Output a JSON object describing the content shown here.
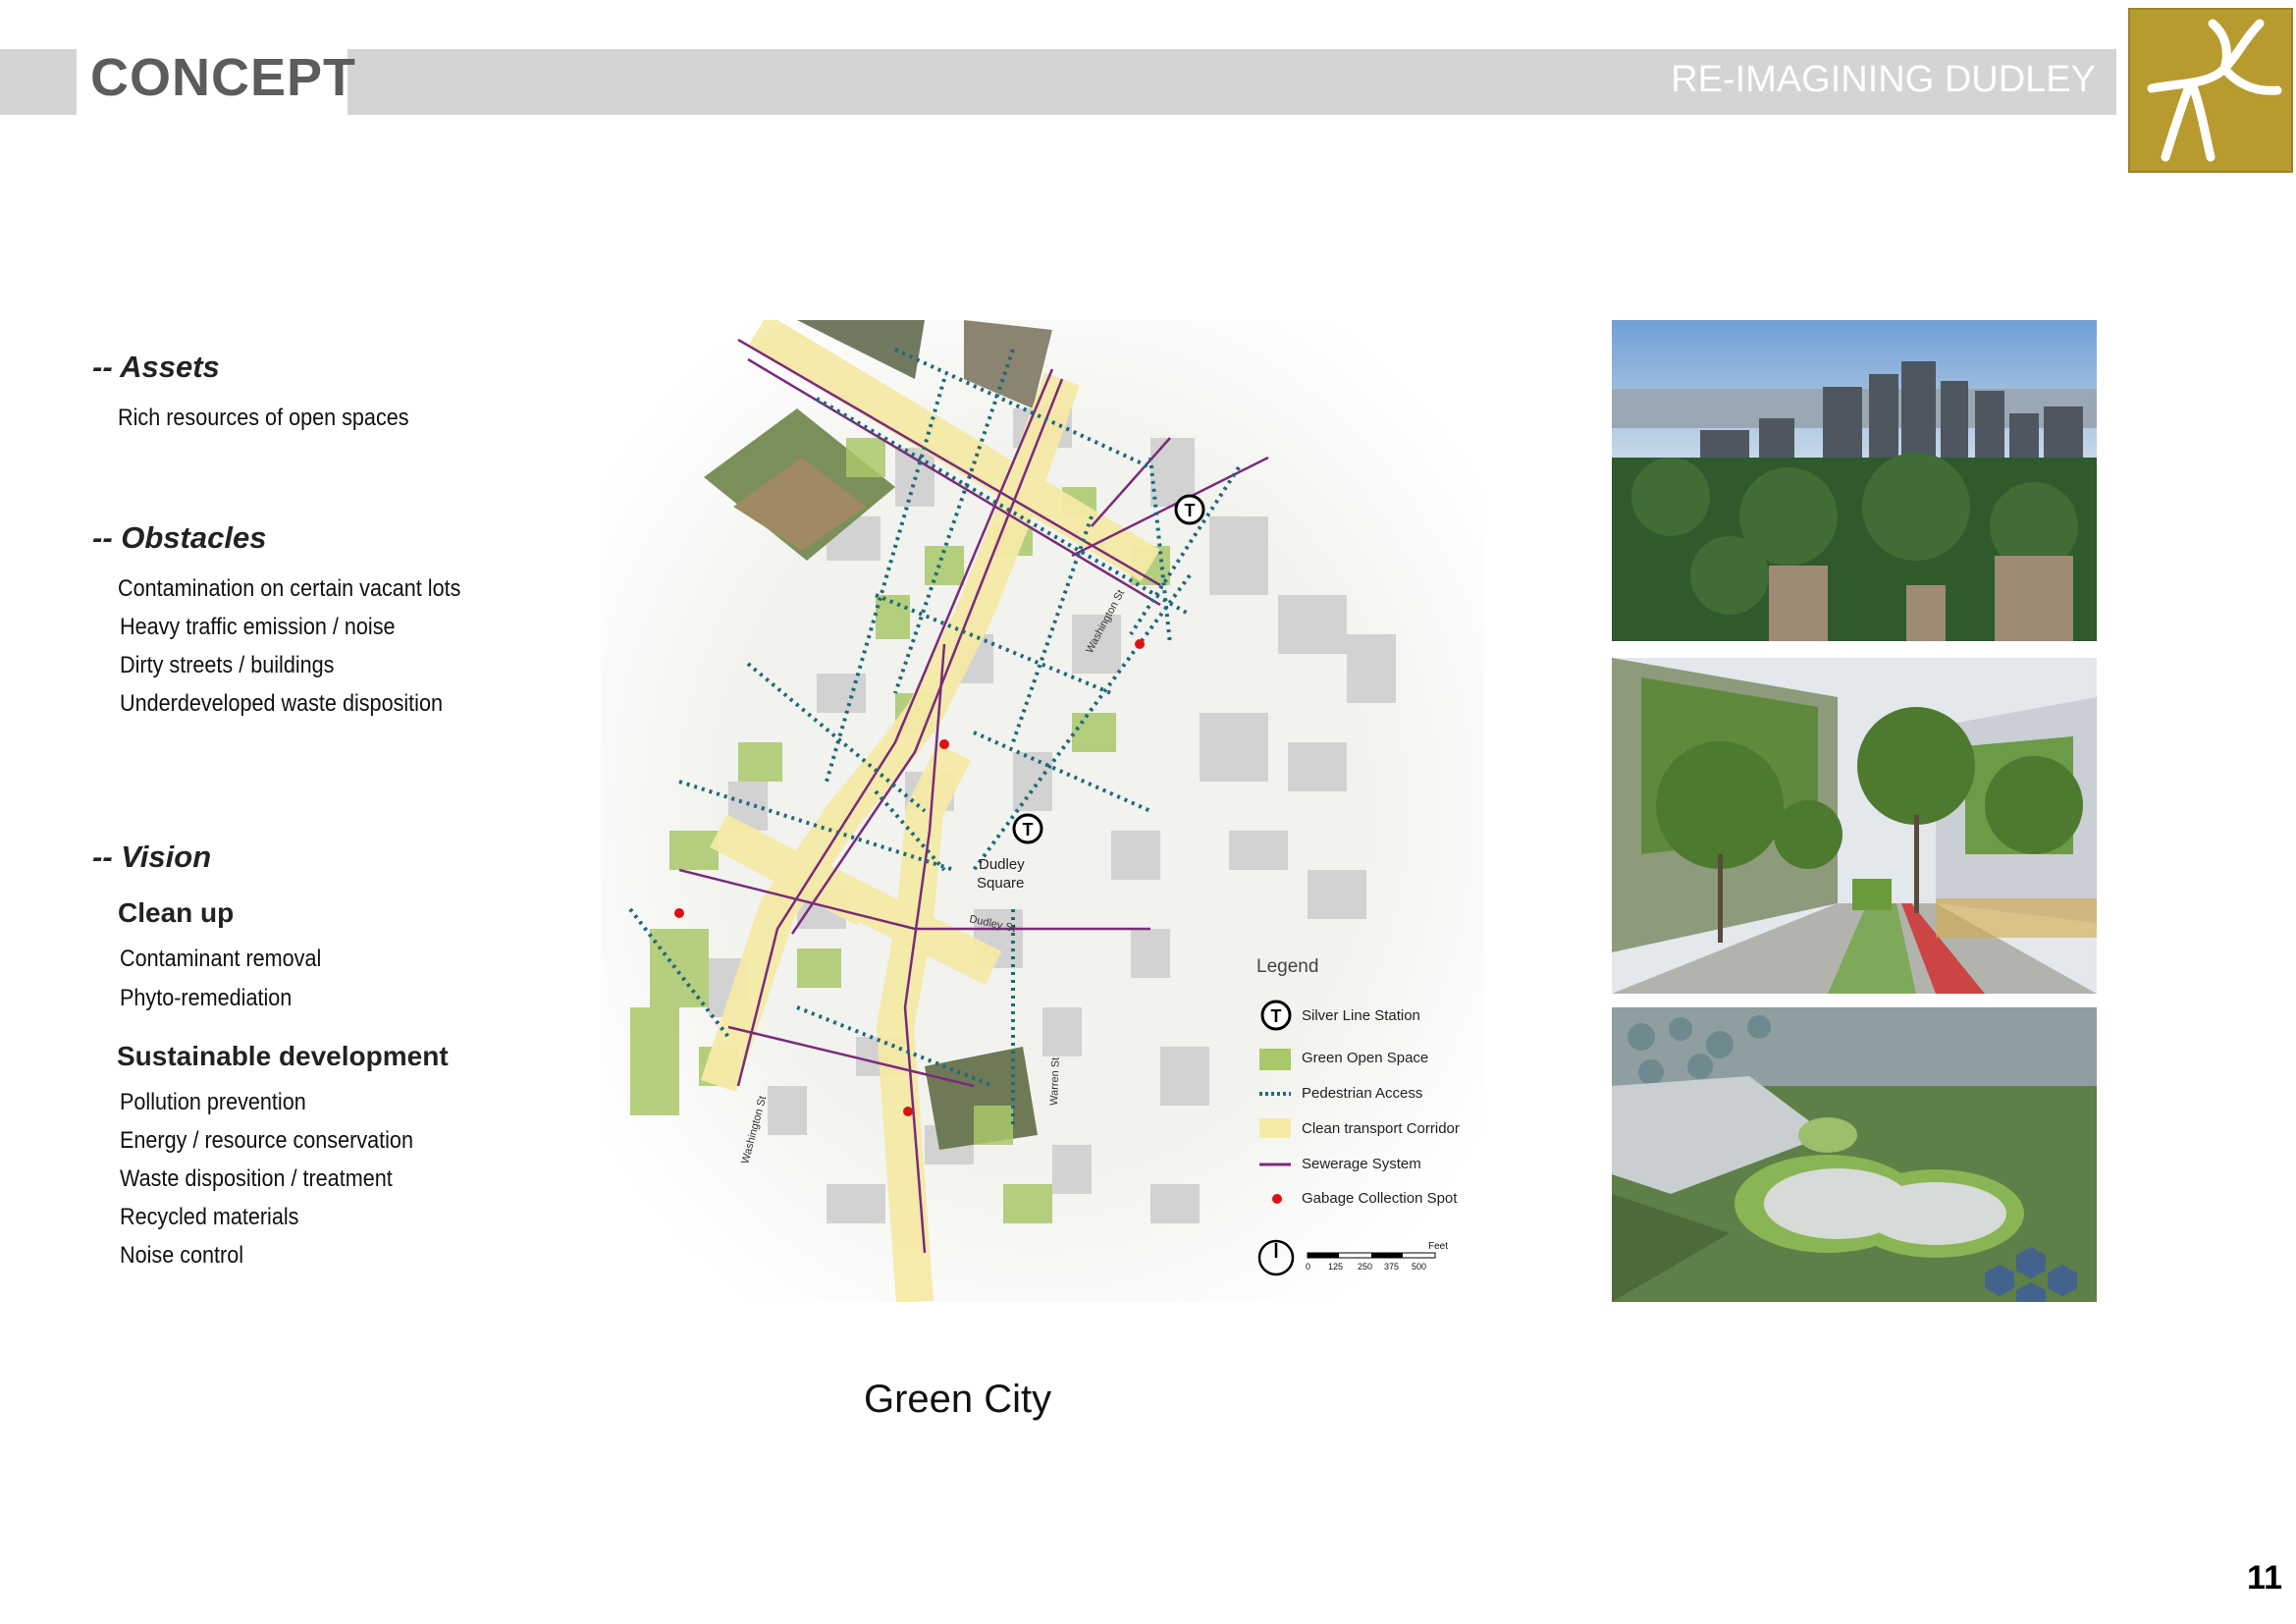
{
  "header": {
    "section_title": "CONCEPT",
    "subtitle": "RE-IMAGINING DUDLEY",
    "logo_icon": "road-junction-icon",
    "logo_color": "#b89b2e"
  },
  "left": {
    "assets": {
      "heading": "-- Assets",
      "items": [
        "Rich resources of open spaces"
      ]
    },
    "obstacles": {
      "heading": "-- Obstacles",
      "items": [
        "Contamination on certain vacant lots",
        "Heavy traffic emission / noise",
        "Dirty streets / buildings",
        "Underdeveloped waste disposition"
      ]
    },
    "vision": {
      "heading": "-- Vision",
      "clean_up": {
        "heading": "Clean up",
        "items": [
          "Contaminant removal",
          "Phyto-remediation"
        ]
      },
      "sustainable": {
        "heading": "Sustainable development",
        "items": [
          "Pollution prevention",
          "Energy / resource conservation",
          "Waste disposition / treatment",
          "Recycled materials",
          "Noise control"
        ]
      }
    }
  },
  "map": {
    "square_label_1": "Dudley",
    "square_label_2": "Square",
    "street_dudley": "Dudley St",
    "street_washington": "Washington St",
    "street_warren": "Warren St",
    "street_washington_2": "Washington St",
    "station_symbol": "T",
    "legend": {
      "title": "Legend",
      "items": [
        {
          "label": "Silver Line Station",
          "symbol": "station-icon"
        },
        {
          "label": "Green Open Space",
          "symbol": "green-swatch",
          "color": "#a9c86a"
        },
        {
          "label": "Pedestrian Access",
          "symbol": "dotted-line",
          "color": "#1e6a7a"
        },
        {
          "label": "Clean transport Corridor",
          "symbol": "yellow-swatch",
          "color": "#f5eaa6"
        },
        {
          "label": "Sewerage System",
          "symbol": "purple-line",
          "color": "#7a2b7a"
        },
        {
          "label": "Gabage Collection Spot",
          "symbol": "red-dot",
          "color": "#d11"
        }
      ],
      "scale_unit": "Feet",
      "scale_ticks": [
        "0",
        "125",
        "250",
        "375",
        "500"
      ]
    }
  },
  "photos": [
    {
      "icon": "city-skyline-photo"
    },
    {
      "icon": "green-street-tram-photo"
    },
    {
      "icon": "green-roof-development-photo"
    }
  ],
  "caption": "Green City",
  "page_number": "11"
}
